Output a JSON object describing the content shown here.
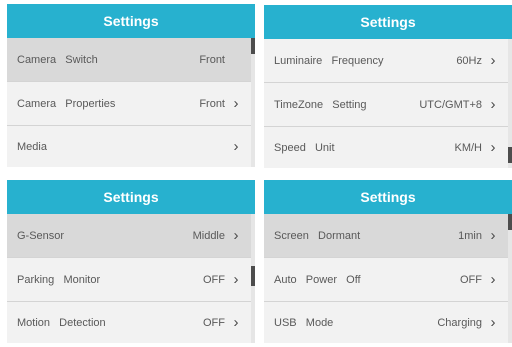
{
  "panels": [
    {
      "title": "Settings",
      "rows": [
        {
          "label": "Camera   Switch",
          "value": "Front",
          "chevron": ""
        },
        {
          "label": "Camera   Properties",
          "value": "Front",
          "chevron": "›"
        },
        {
          "label": "Media",
          "value": "",
          "chevron": "›"
        }
      ]
    },
    {
      "title": "Settings",
      "rows": [
        {
          "label": "Luminaire   Frequency",
          "value": "60Hz",
          "chevron": "›"
        },
        {
          "label": "TimeZone   Setting",
          "value": "UTC/GMT+8",
          "chevron": "›"
        },
        {
          "label": "Speed   Unit",
          "value": "KM/H",
          "chevron": "›"
        }
      ]
    },
    {
      "title": "Settings",
      "rows": [
        {
          "label": "G-Sensor",
          "value": "Middle",
          "chevron": "›"
        },
        {
          "label": "Parking   Monitor",
          "value": "OFF",
          "chevron": "›"
        },
        {
          "label": "Motion   Detection",
          "value": "OFF",
          "chevron": "›"
        }
      ]
    },
    {
      "title": "Settings",
      "rows": [
        {
          "label": "Screen   Dormant",
          "value": "1min",
          "chevron": "›"
        },
        {
          "label": "Auto   Power   Off",
          "value": "OFF",
          "chevron": "›"
        },
        {
          "label": "USB   Mode",
          "value": "Charging",
          "chevron": "›"
        }
      ]
    }
  ]
}
